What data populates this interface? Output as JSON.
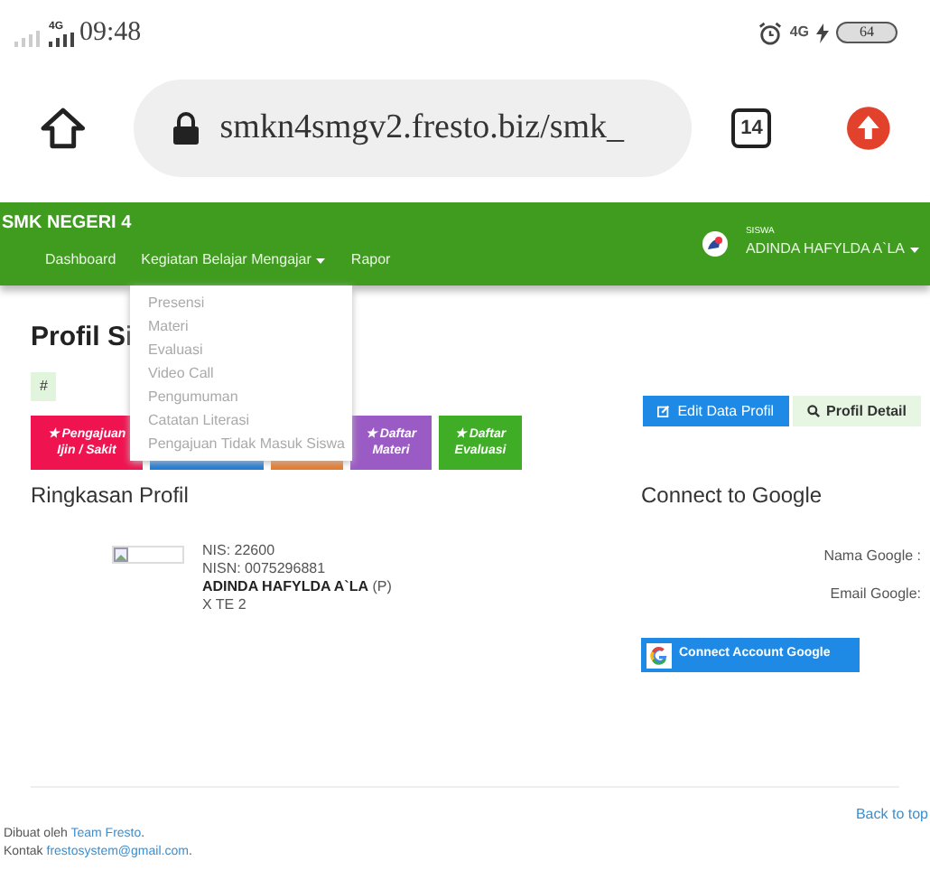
{
  "status_bar": {
    "network": "4G",
    "time": "09:48",
    "network_right": "4G",
    "battery": "64"
  },
  "browser": {
    "url": "smkn4smgv2.fresto.biz/smk_",
    "tab_count": "14"
  },
  "navbar": {
    "brand": "SMK NEGERI 4",
    "items": [
      {
        "label": "Dashboard",
        "kind": "link"
      },
      {
        "label": "Kegiatan Belajar Mengajar",
        "kind": "dropdown"
      },
      {
        "label": "Rapor",
        "kind": "link"
      }
    ],
    "user": {
      "role": "SISWA",
      "name": "ADINDA HAFYLDA A`LA"
    }
  },
  "dropdown": {
    "items": [
      "Presensi",
      "Materi",
      "Evaluasi",
      "Video Call",
      "Pengumuman",
      "Catatan Literasi",
      "Pengajuan Tidak Masuk Siswa"
    ]
  },
  "page": {
    "title": "Profil Si",
    "badge": "#",
    "actions": [
      {
        "label": "Edit Data Profil",
        "kind": "edit"
      },
      {
        "label": "Profil Detail",
        "kind": "detail"
      }
    ],
    "tiles": [
      {
        "icon": "★",
        "lines": [
          "Pengajuan",
          "Ijin / Sakit"
        ],
        "color": "#ef1350"
      },
      {
        "color": "#1f7ad4"
      },
      {
        "color": "#e67a2c"
      },
      {
        "icon": "★",
        "lines": [
          "Daftar",
          "Materi"
        ],
        "color": "#9b5bc4"
      },
      {
        "icon": "★",
        "lines": [
          "Daftar",
          "Evaluasi"
        ],
        "color": "#3fae26"
      }
    ]
  },
  "profile": {
    "title": "Ringkasan Profil",
    "nis": "NIS: 22600",
    "nisn": "NISN: 0075296881",
    "name": "ADINDA HAFYLDA A`LA",
    "gender": "(P)",
    "class": "X TE 2"
  },
  "google": {
    "title": "Connect to Google",
    "fields": [
      "Nama Google :",
      "Email Google:"
    ],
    "button": "Connect Account Google"
  },
  "footer": {
    "back_to_top": "Back to top",
    "credit": "Dibuat oleh ",
    "credit_link": "Team Fresto",
    "credit_end": ".",
    "contact": "Kontak ",
    "contact_link": "frestosystem@gmail.com",
    "contact_end": "."
  }
}
